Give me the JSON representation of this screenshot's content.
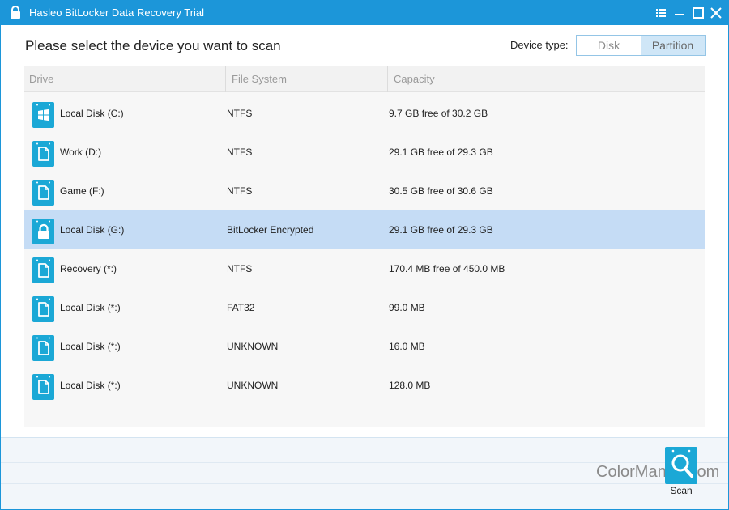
{
  "window": {
    "title": "Hasleo BitLocker Data Recovery Trial"
  },
  "heading": "Please select the device you want to scan",
  "device_type": {
    "label": "Device type:",
    "options": [
      "Disk",
      "Partition"
    ],
    "selected": "Partition"
  },
  "table": {
    "columns": [
      "Drive",
      "File System",
      "Capacity"
    ],
    "rows": [
      {
        "icon": "windows-drive-icon",
        "name": "Local Disk (C:)",
        "fs": "NTFS",
        "capacity": "9.7 GB free of 30.2 GB",
        "selected": false
      },
      {
        "icon": "drive-icon",
        "name": "Work (D:)",
        "fs": "NTFS",
        "capacity": "29.1 GB free of 29.3 GB",
        "selected": false
      },
      {
        "icon": "drive-icon",
        "name": "Game (F:)",
        "fs": "NTFS",
        "capacity": "30.5 GB free of 30.6 GB",
        "selected": false
      },
      {
        "icon": "locked-drive-icon",
        "name": "Local Disk (G:)",
        "fs": "BitLocker Encrypted",
        "capacity": "29.1 GB free of 29.3 GB",
        "selected": true
      },
      {
        "icon": "drive-icon",
        "name": "Recovery (*:)",
        "fs": "NTFS",
        "capacity": "170.4 MB free of 450.0 MB",
        "selected": false
      },
      {
        "icon": "drive-icon",
        "name": "Local Disk (*:)",
        "fs": "FAT32",
        "capacity": "99.0 MB",
        "selected": false
      },
      {
        "icon": "drive-icon",
        "name": "Local Disk (*:)",
        "fs": "UNKNOWN",
        "capacity": "16.0 MB",
        "selected": false
      },
      {
        "icon": "drive-icon",
        "name": "Local Disk (*:)",
        "fs": "UNKNOWN",
        "capacity": "128.0 MB",
        "selected": false
      }
    ]
  },
  "scan_label": "Scan",
  "watermark": "ColorMango.com",
  "colors": {
    "accent": "#1c96d9",
    "selected_row": "#c5dcf5",
    "icon": "#1ba8d6"
  }
}
